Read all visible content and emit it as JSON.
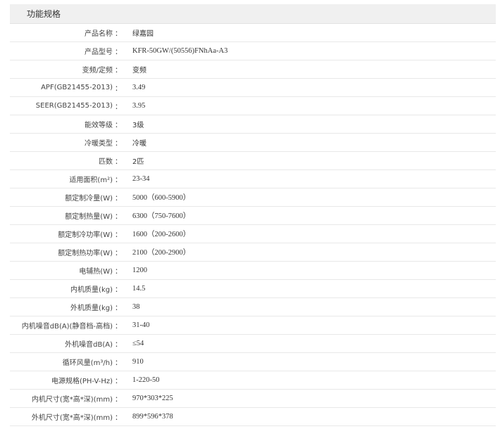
{
  "section_title": "功能规格",
  "colon": "：",
  "specs": [
    {
      "label": "产品名称",
      "value": "绿嘉园"
    },
    {
      "label": "产品型号",
      "value": "KFR-50GW/(50556)FNhAa-A3"
    },
    {
      "label": "变频/定频",
      "value": "变频"
    },
    {
      "label": "APF(GB21455-2013)",
      "value": "3.49"
    },
    {
      "label": "SEER(GB21455-2013)",
      "value": "3.95"
    },
    {
      "label": "能效等级",
      "value": "3级"
    },
    {
      "label": "冷暖类型",
      "value": "冷暖"
    },
    {
      "label": "匹数",
      "value": "2匹"
    },
    {
      "label": "适用面积(m²)",
      "value": "23-34"
    },
    {
      "label": "额定制冷量(W)",
      "value": "5000（600-5900）"
    },
    {
      "label": "额定制热量(W)",
      "value": "6300（750-7600）"
    },
    {
      "label": "额定制冷功率(W)",
      "value": "1600（200-2600）"
    },
    {
      "label": "额定制热功率(W)",
      "value": "2100（200-2900）"
    },
    {
      "label": "电辅热(W)",
      "value": "1200"
    },
    {
      "label": "内机质量(kg)",
      "value": "14.5"
    },
    {
      "label": "外机质量(kg)",
      "value": "38"
    },
    {
      "label": "内机噪音dB(A)(静音档-高档)",
      "value": "31-40"
    },
    {
      "label": "外机噪音dB(A)",
      "value": "≤54"
    },
    {
      "label": "循环风量(m³/h)",
      "value": "910"
    },
    {
      "label": "电源规格(PH-V-Hz)",
      "value": "1-220-50"
    },
    {
      "label": "内机尺寸(宽*高*深)(mm)",
      "value": "970*303*225"
    },
    {
      "label": "外机尺寸(宽*高*深)(mm)",
      "value": "899*596*378"
    }
  ]
}
